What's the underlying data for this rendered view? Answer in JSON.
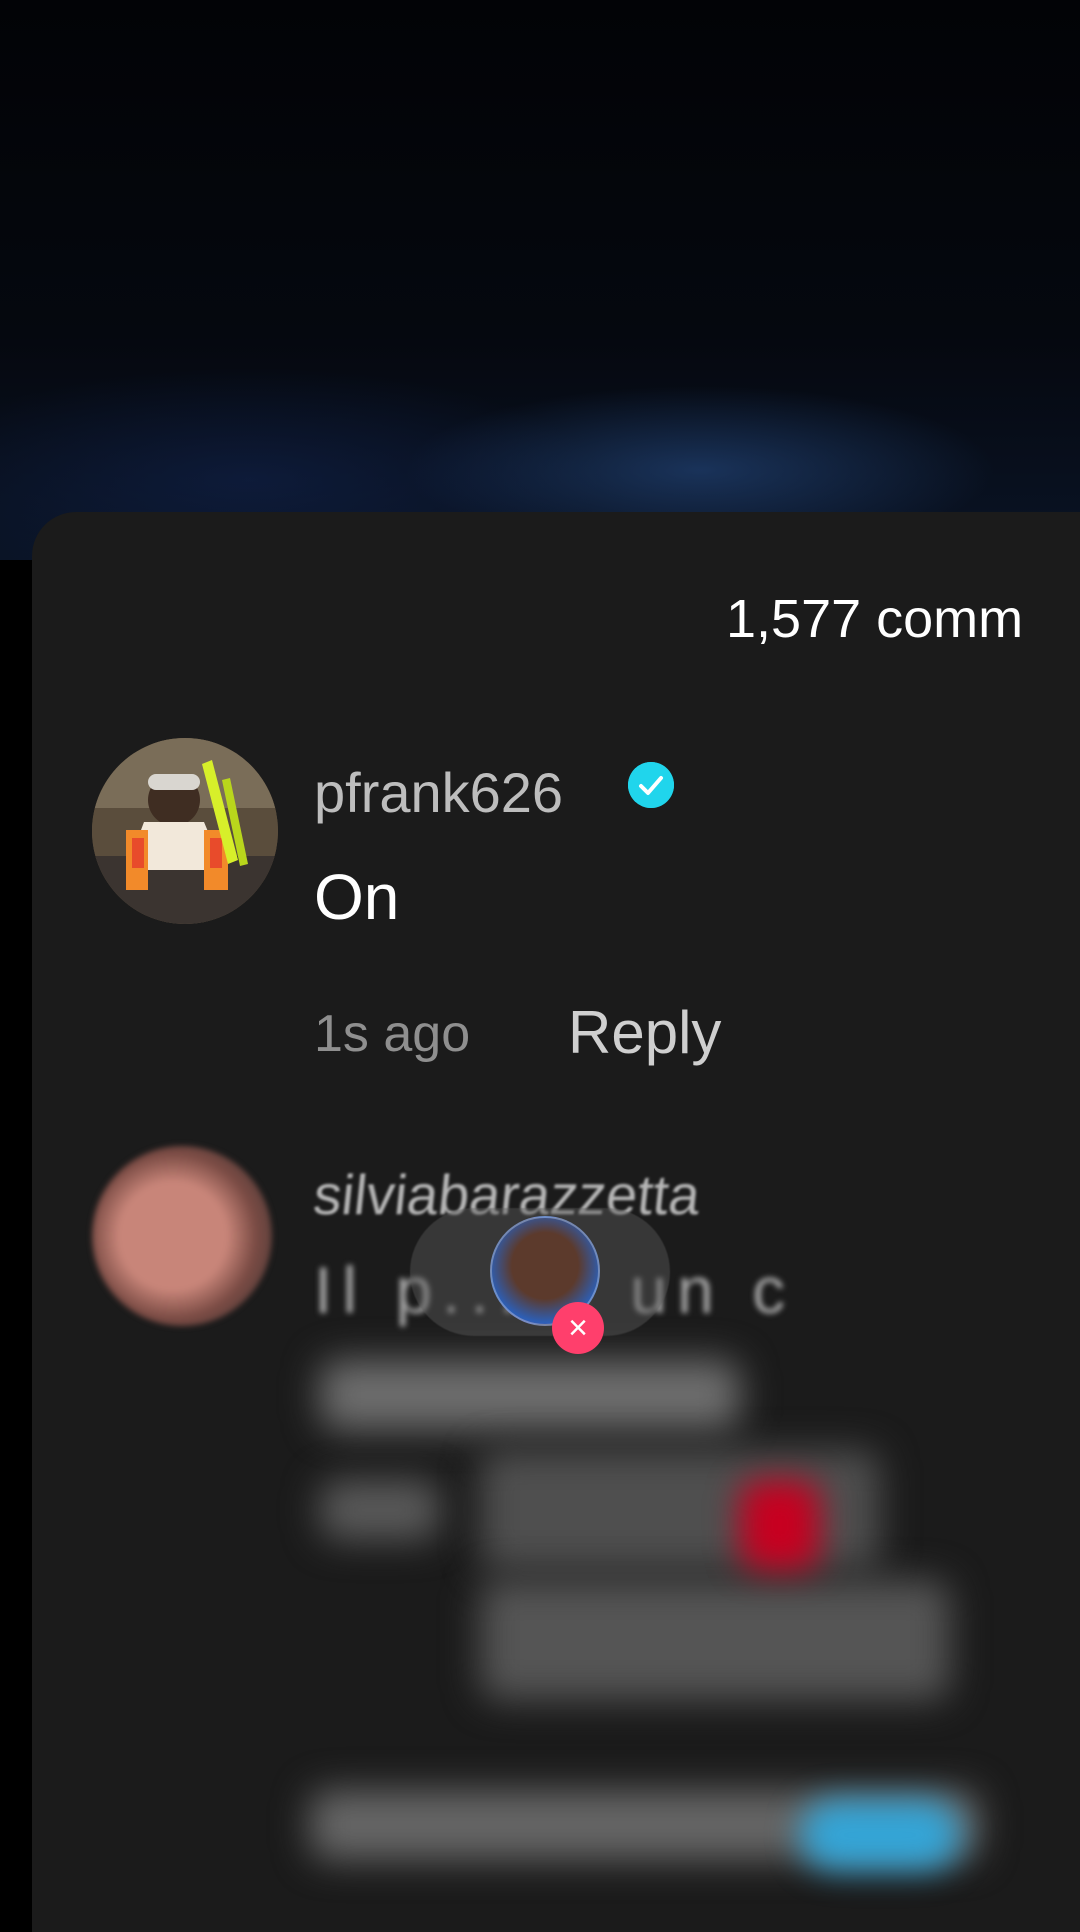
{
  "header": {
    "comment_count": "1,577 comm"
  },
  "comments": [
    {
      "username": "pfrank626",
      "text": "On",
      "time": "1s ago",
      "reply_label": "Reply",
      "verified": true
    },
    {
      "username": "silviabarazzetta",
      "text": "Il p... é un c"
    }
  ],
  "colors": {
    "background": "#000000",
    "sheet": "#1b1b1b",
    "verified_badge": "#20d5ec",
    "close_badge": "#ff3f6c"
  },
  "icons": {
    "verified": "verified-check-icon",
    "close": "close-icon"
  }
}
